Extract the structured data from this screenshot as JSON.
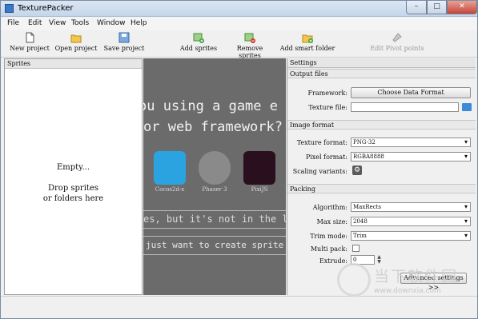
{
  "window": {
    "title": "TexturePacker",
    "min_glyph": "–",
    "max_glyph": "□",
    "close_glyph": "✕"
  },
  "menu": [
    "File",
    "Edit",
    "View",
    "Tools",
    "Window",
    "Help"
  ],
  "toolbar": [
    {
      "label": "New project",
      "icon": "new-project-icon"
    },
    {
      "label": "Open project",
      "icon": "open-project-icon"
    },
    {
      "label": "Save project",
      "icon": "save-project-icon"
    },
    {
      "label": "Add sprites",
      "icon": "add-sprites-icon"
    },
    {
      "label": "Remove sprites",
      "icon": "remove-sprites-icon"
    },
    {
      "label": "Add smart folder",
      "icon": "add-smart-folder-icon"
    },
    {
      "label": "Edit Pivot points",
      "icon": "pivot-points-icon",
      "disabled": true
    }
  ],
  "sprites_panel": {
    "title": "Sprites",
    "empty_title": "Empty...",
    "drop_hint_1": "Drop sprites",
    "drop_hint_2": "or folders here"
  },
  "promo": {
    "line1": "ou using a game e",
    "line2": "or web framework?",
    "line3": "es, but it's not in the lis",
    "line4": "just want to create sprite",
    "frameworks": [
      "Cocos2d-x",
      "Phaser 3",
      "PixiJS"
    ]
  },
  "settings": {
    "title": "Settings",
    "output_files": {
      "title": "Output files",
      "framework_label": "Framework:",
      "framework_button": "Choose Data Format",
      "texture_file_label": "Texture file:",
      "texture_file_value": ""
    },
    "image_format": {
      "title": "Image format",
      "texture_format_label": "Texture format:",
      "texture_format_value": "PNG-32",
      "pixel_format_label": "Pixel format:",
      "pixel_format_value": "RGBA8888",
      "scaling_variants_label": "Scaling variants:"
    },
    "packing": {
      "title": "Packing",
      "algorithm_label": "Algorithm:",
      "algorithm_value": "MaxRects",
      "max_size_label": "Max size:",
      "max_size_value": "2048",
      "trim_mode_label": "Trim mode:",
      "trim_mode_value": "Trim",
      "multi_pack_label": "Multi pack:",
      "multi_pack_checked": false,
      "extrude_label": "Extrude:",
      "extrude_value": "0",
      "advanced_button": "Advanced settings >>"
    }
  },
  "watermark": {
    "text": "当下软件园",
    "url": "www.downxia.com"
  }
}
